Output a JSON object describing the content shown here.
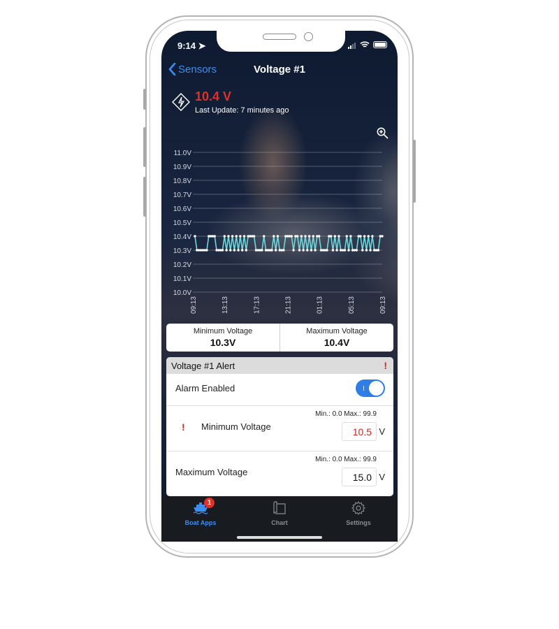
{
  "status_bar": {
    "time": "9:14"
  },
  "nav": {
    "back_label": "Sensors",
    "title": "Voltage #1"
  },
  "sensor": {
    "reading": "10.4 V",
    "last_update": "Last Update: 7 minutes ago",
    "reading_color": "#e0302a"
  },
  "chart_data": {
    "type": "line",
    "title": "",
    "xlabel": "",
    "ylabel": "",
    "ylim": [
      10.0,
      11.0
    ],
    "y_ticks": [
      "11.0V",
      "10.9V",
      "10.8V",
      "10.7V",
      "10.6V",
      "10.5V",
      "10.4V",
      "10.3V",
      "10.2V",
      "10.1V",
      "10.0V"
    ],
    "x_ticks": [
      "09:13",
      "13:13",
      "17:13",
      "21:13",
      "01:13",
      "05:13",
      "09:13"
    ],
    "grid": true,
    "series": [
      {
        "name": "Voltage",
        "color": "#6fd8dc",
        "values": [
          10.4,
          10.3,
          10.3,
          10.3,
          10.3,
          10.3,
          10.3,
          10.4,
          10.4,
          10.4,
          10.4,
          10.3,
          10.3,
          10.3,
          10.3,
          10.4,
          10.3,
          10.4,
          10.3,
          10.4,
          10.3,
          10.4,
          10.3,
          10.4,
          10.3,
          10.4,
          10.3,
          10.4,
          10.4,
          10.4,
          10.4,
          10.3,
          10.3,
          10.3,
          10.3,
          10.4,
          10.3,
          10.3,
          10.3,
          10.3,
          10.4,
          10.3,
          10.4,
          10.3,
          10.3,
          10.3,
          10.4,
          10.4,
          10.4,
          10.4,
          10.3,
          10.4,
          10.4,
          10.3,
          10.4,
          10.3,
          10.4,
          10.3,
          10.4,
          10.3,
          10.4,
          10.3,
          10.4,
          10.4,
          10.3,
          10.3,
          10.3,
          10.3,
          10.4,
          10.4,
          10.3,
          10.4,
          10.3,
          10.4,
          10.3,
          10.3,
          10.3,
          10.4,
          10.3,
          10.4,
          10.3,
          10.3,
          10.3,
          10.4,
          10.4,
          10.3,
          10.4,
          10.3,
          10.4,
          10.3,
          10.4,
          10.3,
          10.3,
          10.3,
          10.4,
          10.4
        ]
      }
    ]
  },
  "stats": {
    "min_label": "Minimum Voltage",
    "min_value": "10.3V",
    "max_label": "Maximum Voltage",
    "max_value": "10.4V"
  },
  "alert": {
    "title": "Voltage #1 Alert",
    "warning_glyph": "!",
    "alarm_label": "Alarm Enabled",
    "alarm_enabled": true,
    "min_label": "Minimum Voltage",
    "min_range": "Min.: 0.0 Max.: 99.9",
    "min_value": "10.5",
    "max_label": "Maximum Voltage",
    "max_range": "Min.: 0.0 Max.: 99.9",
    "max_value": "15.0",
    "unit": "V"
  },
  "tabs": [
    {
      "label": "Boat Apps",
      "icon": "boat-icon",
      "badge": "1",
      "active": true
    },
    {
      "label": "Chart",
      "icon": "map-icon",
      "active": false
    },
    {
      "label": "Settings",
      "icon": "gear-icon",
      "active": false
    }
  ],
  "colors": {
    "accent": "#3d8ef2",
    "alert": "#e0302a",
    "line": "#6fd8dc"
  }
}
